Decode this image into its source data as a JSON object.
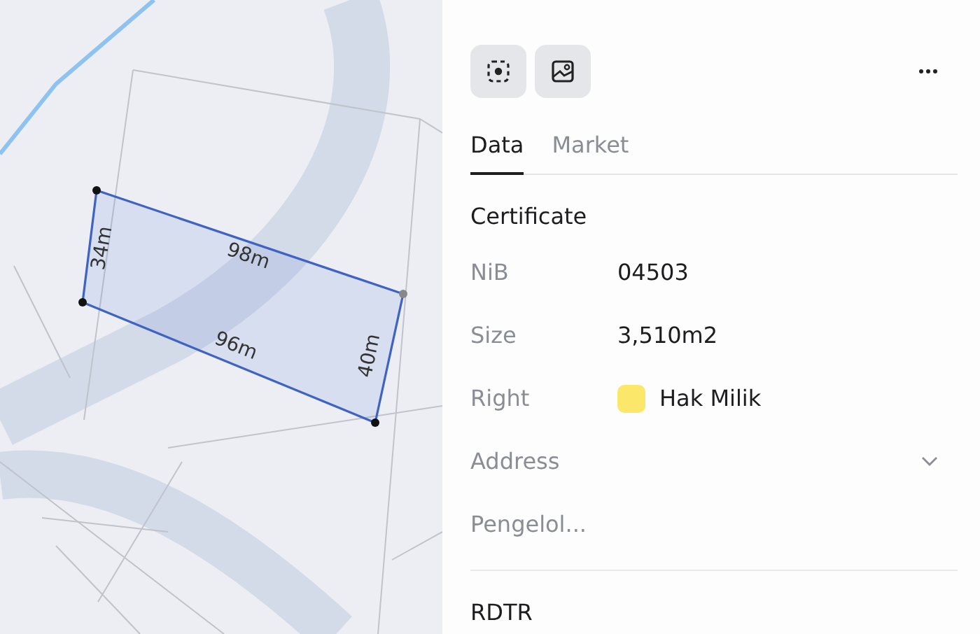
{
  "map": {
    "measurements": [
      "34m",
      "98m",
      "40m",
      "96m"
    ]
  },
  "tabs": [
    {
      "label": "Data",
      "selected": true
    },
    {
      "label": "Market",
      "selected": false
    }
  ],
  "sections": [
    {
      "title": "Certificate",
      "rows": [
        {
          "kind": "text",
          "label": "NiB",
          "value": "04503"
        },
        {
          "kind": "text",
          "label": "Size",
          "value": "3,510m2"
        },
        {
          "kind": "swatch",
          "label": "Right",
          "value": "Hak Milik",
          "color": "#fbe86a"
        },
        {
          "kind": "expandable",
          "label": "Address",
          "expanded": false
        },
        {
          "kind": "text",
          "label": "Pengelol..."
        }
      ]
    },
    {
      "title": "RDTR"
    }
  ]
}
